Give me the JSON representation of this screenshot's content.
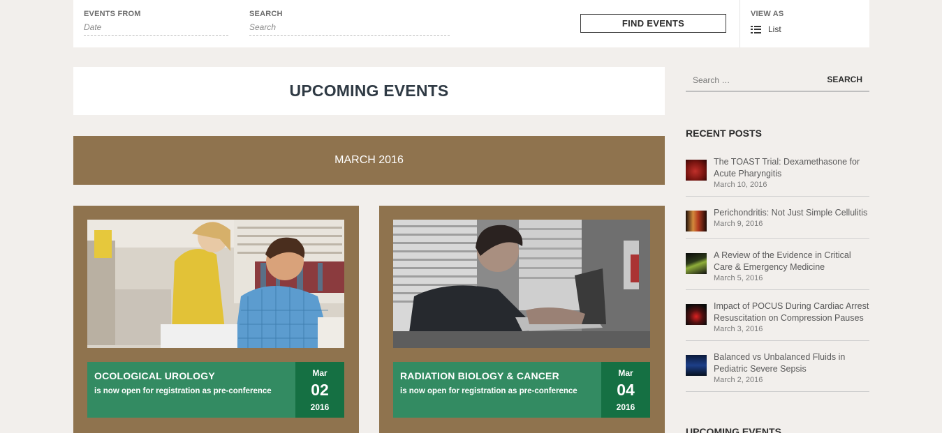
{
  "filter_bar": {
    "events_from_label": "EVENTS FROM",
    "events_from_placeholder": "Date",
    "search_label": "SEARCH",
    "search_placeholder": "Search",
    "find_button": "FIND EVENTS",
    "view_as_label": "VIEW AS",
    "view_option": "List"
  },
  "main": {
    "page_title": "UPCOMING EVENTS",
    "month_heading": "MARCH 2016",
    "events": [
      {
        "title": "OCOLOGICAL UROLOGY",
        "subtitle": "is now open for registration as pre-conference",
        "month": "Mar",
        "day": "02",
        "year": "2016"
      },
      {
        "title": "RADIATION BIOLOGY & CANCER",
        "subtitle": "is now open for registration as pre-conference",
        "month": "Mar",
        "day": "04",
        "year": "2016"
      }
    ]
  },
  "sidebar": {
    "search_placeholder": "Search …",
    "search_button": "SEARCH",
    "recent_posts_heading": "RECENT POSTS",
    "posts": [
      {
        "title": "The TOAST Trial: Dexamethasone for Acute Pharyngitis",
        "date": "March 10, 2016"
      },
      {
        "title": "Perichondritis: Not Just Simple Cellulitis",
        "date": "March 9, 2016"
      },
      {
        "title": "A Review of the Evidence in Critical Care & Emergency Medicine",
        "date": "March 5, 2016"
      },
      {
        "title": "Impact of POCUS During Cardiac Arrest Resuscitation on Compression Pauses",
        "date": "March 3, 2016"
      },
      {
        "title": "Balanced vs Unbalanced Fluids in Pediatric Severe Sepsis",
        "date": "March 2, 2016"
      }
    ],
    "upcoming_heading": "UPCOMING EVENTS"
  },
  "colors": {
    "brand_brown": "#8f734e",
    "event_green": "#338b62",
    "event_date_green": "#157043",
    "page_bg": "#f2efec"
  }
}
